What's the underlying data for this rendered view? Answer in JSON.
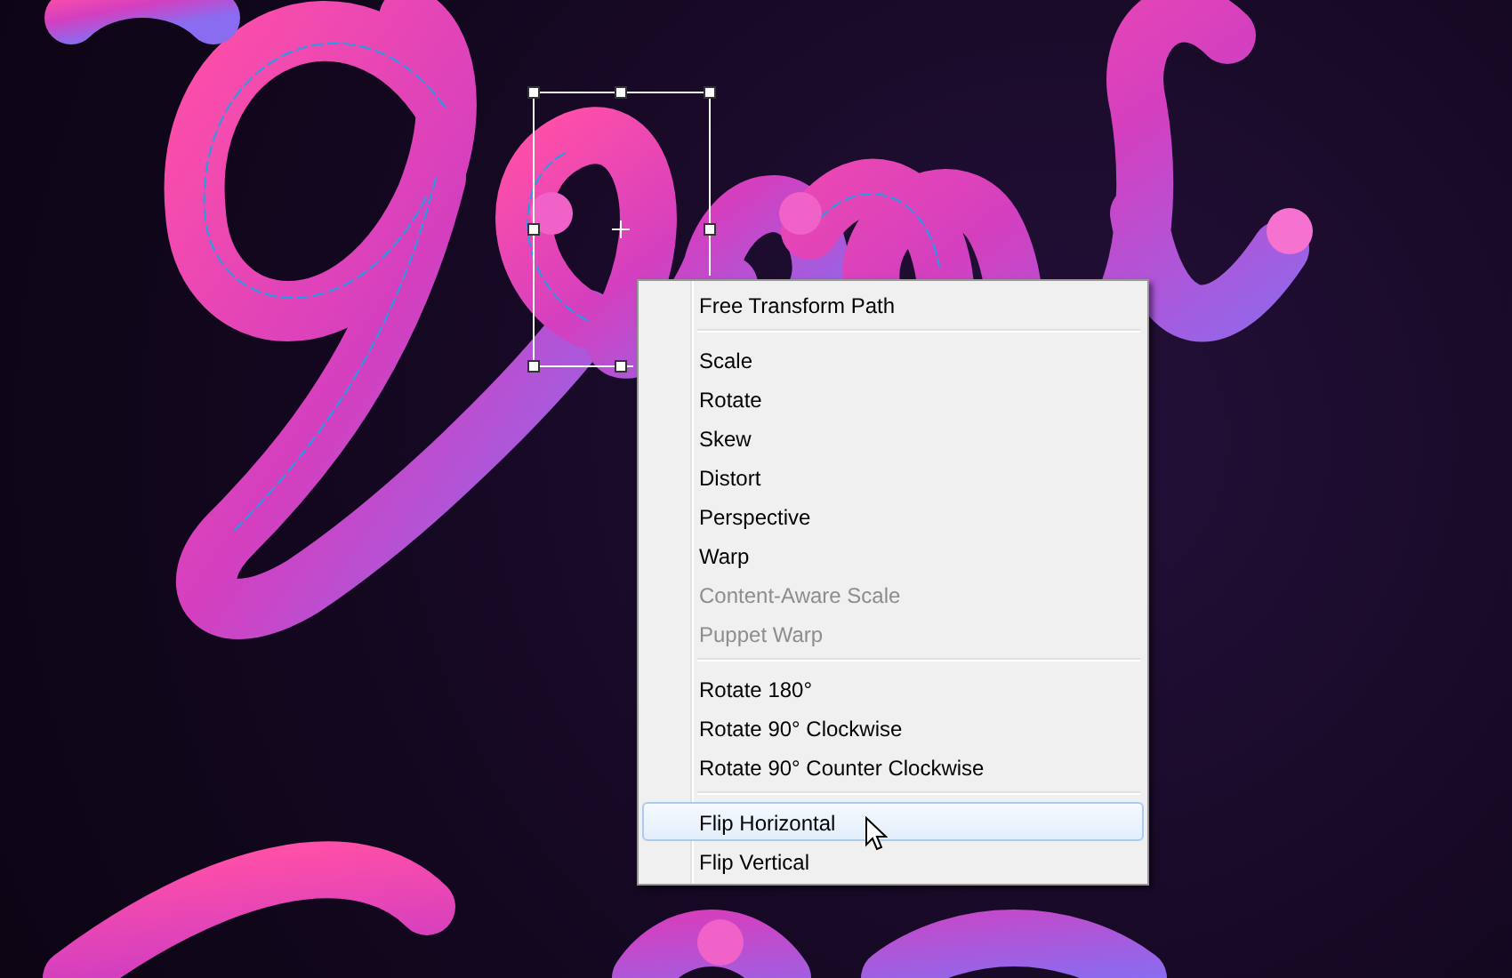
{
  "context_menu": {
    "groups": [
      {
        "items": [
          {
            "label": "Free Transform Path",
            "disabled": false,
            "selected": false
          }
        ]
      },
      {
        "items": [
          {
            "label": "Scale",
            "disabled": false,
            "selected": false
          },
          {
            "label": "Rotate",
            "disabled": false,
            "selected": false
          },
          {
            "label": "Skew",
            "disabled": false,
            "selected": false
          },
          {
            "label": "Distort",
            "disabled": false,
            "selected": false
          },
          {
            "label": "Perspective",
            "disabled": false,
            "selected": false
          },
          {
            "label": "Warp",
            "disabled": false,
            "selected": false
          },
          {
            "label": "Content-Aware Scale",
            "disabled": true,
            "selected": false
          },
          {
            "label": "Puppet Warp",
            "disabled": true,
            "selected": false
          }
        ]
      },
      {
        "items": [
          {
            "label": "Rotate 180°",
            "disabled": false,
            "selected": false
          },
          {
            "label": "Rotate 90° Clockwise",
            "disabled": false,
            "selected": false
          },
          {
            "label": "Rotate 90° Counter Clockwise",
            "disabled": false,
            "selected": false
          }
        ]
      },
      {
        "items": [
          {
            "label": "Flip Horizontal",
            "disabled": false,
            "selected": true
          },
          {
            "label": "Flip Vertical",
            "disabled": false,
            "selected": false
          }
        ]
      }
    ]
  }
}
